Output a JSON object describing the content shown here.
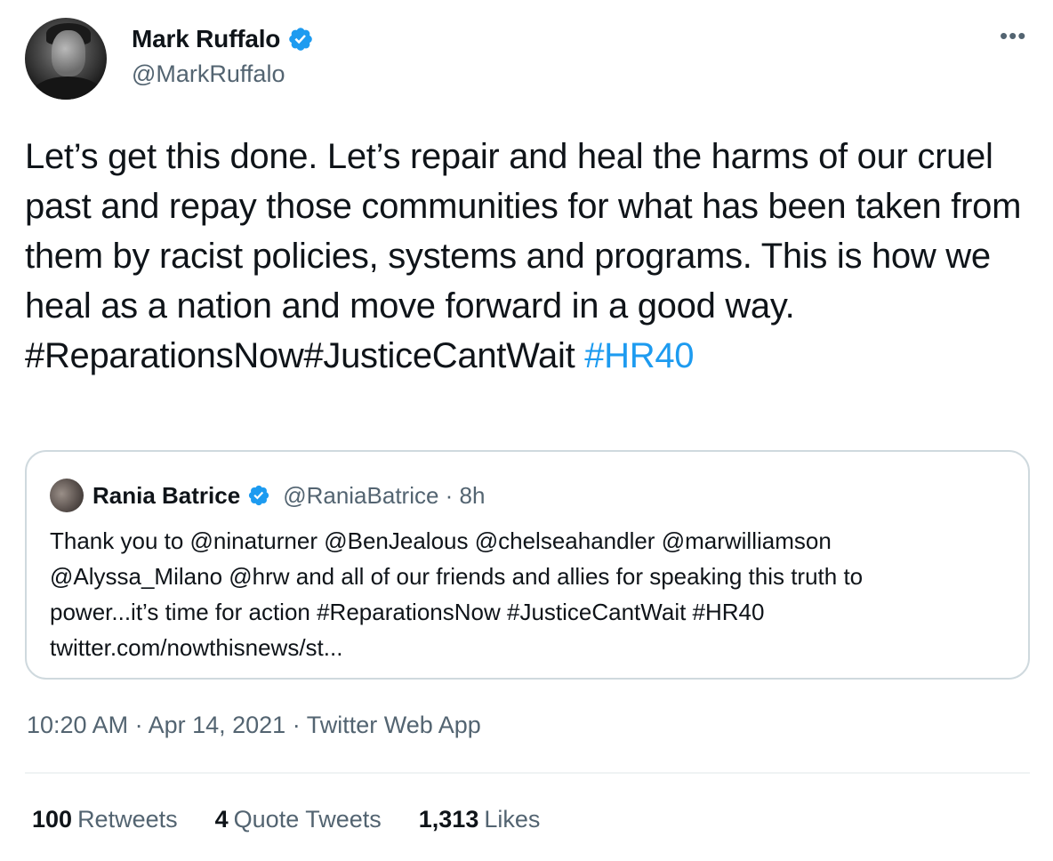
{
  "author": {
    "display_name": "Mark Ruffalo",
    "handle": "@MarkRuffalo",
    "avatar_icon": "profile-photo"
  },
  "more_label": "•••",
  "tweet": {
    "text": "Let’s get this done. Let’s repair and heal the harms of our cruel past and repay those communities for what has been taken from them by racist policies, systems and programs. This is how we heal as a nation and move forward in a good way.",
    "hashtags_plain": "#ReparationsNow#JusticeCantWait",
    "hashtag_link": "#HR40"
  },
  "quote": {
    "display_name": "Rania Batrice",
    "handle_time": "@RaniaBatrice · 8h",
    "text_line1": "Thank you to @ninaturner @BenJealous @chelseahandler @marwilliamson",
    "text_line2": "@Alyssa_Milano @hrw and all of our friends and allies for speaking this truth to",
    "text_line3": "power...it’s time for action #ReparationsNow #JusticeCantWait #HR40",
    "text_line4": "twitter.com/nowthisnews/st..."
  },
  "meta": {
    "timestamp": "10:20 AM · Apr 14, 2021 · Twitter Web App"
  },
  "stats": {
    "retweets_count": "100",
    "retweets_label": "Retweets",
    "quotes_count": "4",
    "quotes_label": "Quote Tweets",
    "likes_count": "1,313",
    "likes_label": "Likes"
  },
  "colors": {
    "link": "#1d9bf0",
    "secondary_text": "#536471",
    "primary_text": "#0f1419",
    "border": "#cfd9de"
  }
}
